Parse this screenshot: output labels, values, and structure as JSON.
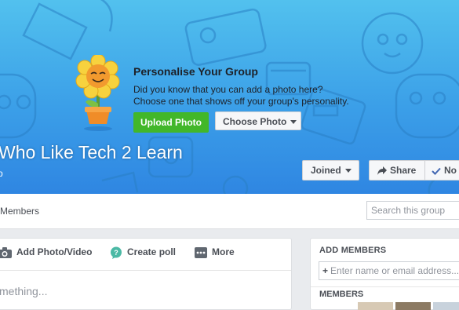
{
  "cover": {
    "promo_title": "Personalise Your Group",
    "promo_line1": "Did you know that you can add a photo here?",
    "promo_line2": "Choose one that shows off your group's personality.",
    "upload_label": "Upload Photo",
    "choose_label": "Choose Photo",
    "group_name": "Who Like Tech 2 Learn",
    "group_sub": "p"
  },
  "actions": {
    "joined_label": "Joined",
    "share_label": "Share",
    "notifications_label": "No"
  },
  "tabbar": {
    "members_label": "Members",
    "search_placeholder": "Search this group"
  },
  "composer": {
    "add_photo_label": "Add Photo/Video",
    "create_poll_label": "Create poll",
    "more_label": "More",
    "placeholder": "mething..."
  },
  "sidebar": {
    "add_members_title": "ADD MEMBERS",
    "add_members_placeholder": "Enter name or email address...",
    "members_title": "MEMBERS"
  },
  "colors": {
    "cover_top": "#52c1ee",
    "cover_bottom": "#2f86e2",
    "upload_green": "#42b72a",
    "page_bg": "#e9ebee",
    "share_check_blue": "#4267b2"
  }
}
